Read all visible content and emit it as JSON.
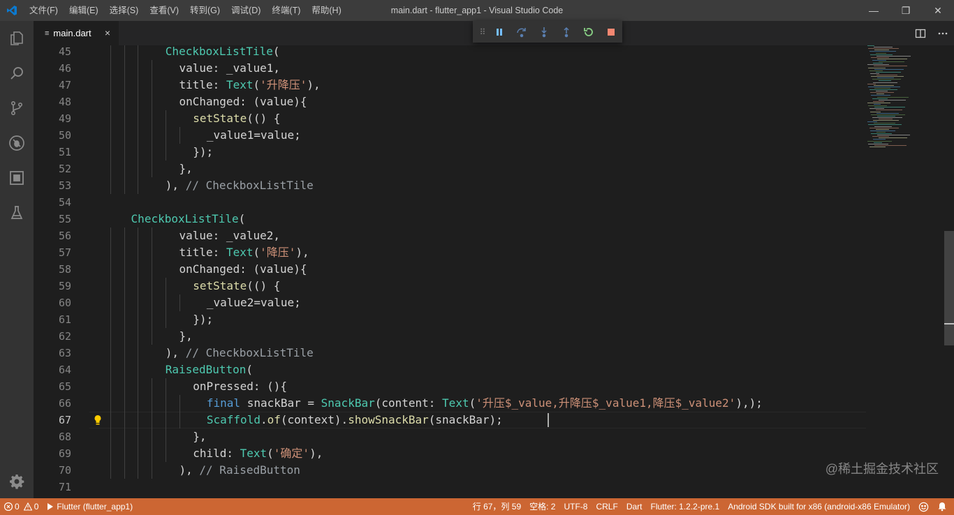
{
  "window": {
    "title": "main.dart - flutter_app1 - Visual Studio Code",
    "menu": [
      "文件(F)",
      "编辑(E)",
      "选择(S)",
      "查看(V)",
      "转到(G)",
      "调试(D)",
      "终端(T)",
      "帮助(H)"
    ],
    "controls": {
      "minimize": "—",
      "maximize": "❐",
      "close": "✕"
    }
  },
  "activity_bar": {
    "icons": [
      "explorer-icon",
      "search-icon",
      "source-control-icon",
      "debug-icon",
      "extensions-icon",
      "flask-icon"
    ],
    "settings_icon": "gear-icon"
  },
  "tabs": [
    {
      "label": "main.dart",
      "file_icon": "≡",
      "close": "×",
      "active": true
    }
  ],
  "tab_actions": [
    "split-editor-icon",
    "more-actions-icon"
  ],
  "debug_toolbar": {
    "buttons": [
      "pause-icon",
      "step-over-icon",
      "step-into-icon",
      "step-out-icon",
      "restart-icon",
      "stop-icon"
    ]
  },
  "editor": {
    "active_line": 67,
    "lines": [
      {
        "num": "45",
        "indent": 4,
        "tokens": [
          [
            "cls",
            "CheckboxListTile"
          ],
          [
            "plain",
            "("
          ]
        ]
      },
      {
        "num": "46",
        "indent": 5,
        "tokens": [
          [
            "plain",
            "value: _value1,"
          ]
        ]
      },
      {
        "num": "47",
        "indent": 5,
        "tokens": [
          [
            "plain",
            "title: "
          ],
          [
            "cls",
            "Text"
          ],
          [
            "plain",
            "("
          ],
          [
            "str",
            "'升降压'"
          ],
          [
            "plain",
            "),"
          ]
        ]
      },
      {
        "num": "48",
        "indent": 5,
        "tokens": [
          [
            "plain",
            "onChanged: (value){"
          ]
        ]
      },
      {
        "num": "49",
        "indent": 6,
        "tokens": [
          [
            "fn",
            "setState"
          ],
          [
            "plain",
            "(() {"
          ]
        ]
      },
      {
        "num": "50",
        "indent": 7,
        "tokens": [
          [
            "plain",
            "_value1=value;"
          ]
        ]
      },
      {
        "num": "51",
        "indent": 6,
        "tokens": [
          [
            "plain",
            "});"
          ]
        ]
      },
      {
        "num": "52",
        "indent": 5,
        "tokens": [
          [
            "plain",
            "},"
          ]
        ]
      },
      {
        "num": "53",
        "indent": 4,
        "tokens": [
          [
            "plain",
            "), "
          ],
          [
            "dim",
            "// CheckboxListTile"
          ]
        ]
      },
      {
        "num": "54",
        "indent": 0,
        "tokens": []
      },
      {
        "num": "55",
        "indent": 1.5,
        "tokens": [
          [
            "cls",
            "CheckboxListTile"
          ],
          [
            "plain",
            "("
          ]
        ]
      },
      {
        "num": "56",
        "indent": 5,
        "tokens": [
          [
            "plain",
            "value: _value2,"
          ]
        ]
      },
      {
        "num": "57",
        "indent": 5,
        "tokens": [
          [
            "plain",
            "title: "
          ],
          [
            "cls",
            "Text"
          ],
          [
            "plain",
            "("
          ],
          [
            "str",
            "'降压'"
          ],
          [
            "plain",
            "),"
          ]
        ]
      },
      {
        "num": "58",
        "indent": 5,
        "tokens": [
          [
            "plain",
            "onChanged: (value){"
          ]
        ]
      },
      {
        "num": "59",
        "indent": 6,
        "tokens": [
          [
            "fn",
            "setState"
          ],
          [
            "plain",
            "(() {"
          ]
        ]
      },
      {
        "num": "60",
        "indent": 7,
        "tokens": [
          [
            "plain",
            "_value2=value;"
          ]
        ]
      },
      {
        "num": "61",
        "indent": 6,
        "tokens": [
          [
            "plain",
            "});"
          ]
        ]
      },
      {
        "num": "62",
        "indent": 5,
        "tokens": [
          [
            "plain",
            "},"
          ]
        ]
      },
      {
        "num": "63",
        "indent": 4,
        "tokens": [
          [
            "plain",
            "), "
          ],
          [
            "dim",
            "// CheckboxListTile"
          ]
        ]
      },
      {
        "num": "64",
        "indent": 4,
        "tokens": [
          [
            "cls",
            "RaisedButton"
          ],
          [
            "plain",
            "("
          ]
        ]
      },
      {
        "num": "65",
        "indent": 6,
        "tokens": [
          [
            "plain",
            "onPressed: (){"
          ]
        ]
      },
      {
        "num": "66",
        "indent": 7,
        "tokens": [
          [
            "kw",
            "final"
          ],
          [
            "plain",
            " snackBar = "
          ],
          [
            "cls",
            "SnackBar"
          ],
          [
            "plain",
            "(content: "
          ],
          [
            "cls",
            "Text"
          ],
          [
            "plain",
            "("
          ],
          [
            "str",
            "'升压$_value,升降压$_value1,降压$_value2'"
          ],
          [
            "plain",
            "),);"
          ]
        ]
      },
      {
        "num": "67",
        "indent": 7,
        "tokens": [
          [
            "cls",
            "Scaffold"
          ],
          [
            "plain",
            "."
          ],
          [
            "fn",
            "of"
          ],
          [
            "plain",
            "(context)."
          ],
          [
            "fn",
            "showSnackBar"
          ],
          [
            "plain",
            "(snackBar);"
          ]
        ]
      },
      {
        "num": "68",
        "indent": 6,
        "tokens": [
          [
            "plain",
            "},"
          ]
        ]
      },
      {
        "num": "69",
        "indent": 6,
        "tokens": [
          [
            "plain",
            "child: "
          ],
          [
            "cls",
            "Text"
          ],
          [
            "plain",
            "("
          ],
          [
            "str",
            "'确定'"
          ],
          [
            "plain",
            "),"
          ]
        ]
      },
      {
        "num": "70",
        "indent": 5,
        "tokens": [
          [
            "plain",
            "), "
          ],
          [
            "dim",
            "// RaisedButton"
          ]
        ]
      },
      {
        "num": "71",
        "indent": 0,
        "tokens": []
      }
    ]
  },
  "watermark": "@稀土掘金技术社区",
  "status_bar": {
    "errors": "0",
    "warnings": "0",
    "debug_target": "Flutter (flutter_app1)",
    "position": "行 67，列 59",
    "spaces": "空格: 2",
    "encoding": "UTF-8",
    "eol": "CRLF",
    "language": "Dart",
    "flutter_version": "Flutter: 1.2.2-pre.1",
    "device": "Android SDK built for x86 (android-x86 Emulator)",
    "color": "#cc6633"
  }
}
